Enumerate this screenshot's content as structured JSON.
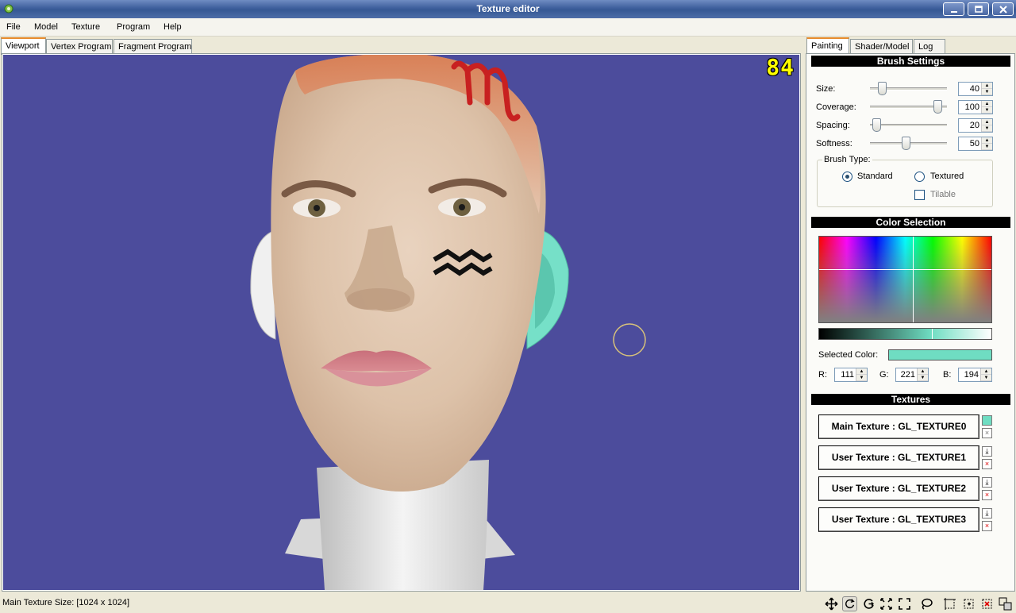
{
  "window": {
    "title": "Texture editor"
  },
  "menu": [
    "File",
    "Model",
    "Texture",
    "Program",
    "Help"
  ],
  "left_tabs": [
    "Viewport",
    "Vertex Program",
    "Fragment Program"
  ],
  "right_tabs": [
    "Painting",
    "Shader/Model",
    "Log"
  ],
  "viewport": {
    "fps": "84",
    "background": "#4c4c9c"
  },
  "brush": {
    "header": "Brush Settings",
    "size": {
      "label": "Size:",
      "value": "40",
      "fraction": 0.12
    },
    "coverage": {
      "label": "Coverage:",
      "value": "100",
      "fraction": 0.93
    },
    "spacing": {
      "label": "Spacing:",
      "value": "20",
      "fraction": 0.03
    },
    "softness": {
      "label": "Softness:",
      "value": "50",
      "fraction": 0.46
    },
    "type_label": "Brush Type:",
    "standard": "Standard",
    "textured": "Textured",
    "tilable": "Tilable",
    "selected_type": "Standard"
  },
  "color": {
    "header": "Color Selection",
    "selected_label": "Selected Color:",
    "selected_hex": "#6fddc2",
    "r_label": "R:",
    "r": "111",
    "g_label": "G:",
    "g": "221",
    "b_label": "B:",
    "b": "194"
  },
  "textures": {
    "header": "Textures",
    "items": [
      "Main Texture : GL_TEXTURE0",
      "User Texture : GL_TEXTURE1",
      "User Texture : GL_TEXTURE2",
      "User Texture : GL_TEXTURE3"
    ]
  },
  "status": {
    "text": "Main Texture Size: [1024 x 1024]"
  },
  "toolbar_icons": [
    "move-icon",
    "rotate-icon",
    "orbit-icon",
    "fit-icon",
    "fullscreen-icon",
    "lasso-icon",
    "select-icon",
    "select-add-icon",
    "select-remove-icon",
    "select-invert-icon"
  ]
}
